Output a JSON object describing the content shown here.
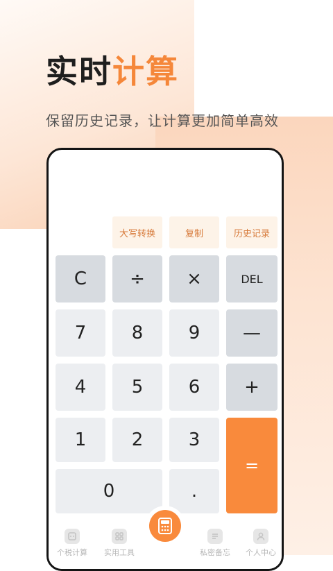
{
  "header": {
    "title_dark": "实时",
    "title_accent": "计算",
    "subtitle": "保留历史记录，让计算更加简单高效"
  },
  "calculator": {
    "function_buttons": {
      "convert": "大写转换",
      "copy": "复制",
      "history": "历史记录"
    },
    "keys": {
      "clear": "C",
      "divide": "÷",
      "multiply": "×",
      "delete": "DEL",
      "seven": "7",
      "eight": "8",
      "nine": "9",
      "minus": "—",
      "four": "4",
      "five": "5",
      "six": "6",
      "plus": "+",
      "one": "1",
      "two": "2",
      "three": "3",
      "equals": "=",
      "zero": "0",
      "dot": "."
    }
  },
  "tabbar": {
    "tax": "个税计算",
    "tools": "实用工具",
    "memo": "私密备忘",
    "profile": "个人中心"
  },
  "colors": {
    "accent": "#f98a3c",
    "title_accent": "#f5873a",
    "operator_key": "#d7dbe0",
    "number_key": "#eceef1",
    "function_key": "#fdf3e8"
  }
}
